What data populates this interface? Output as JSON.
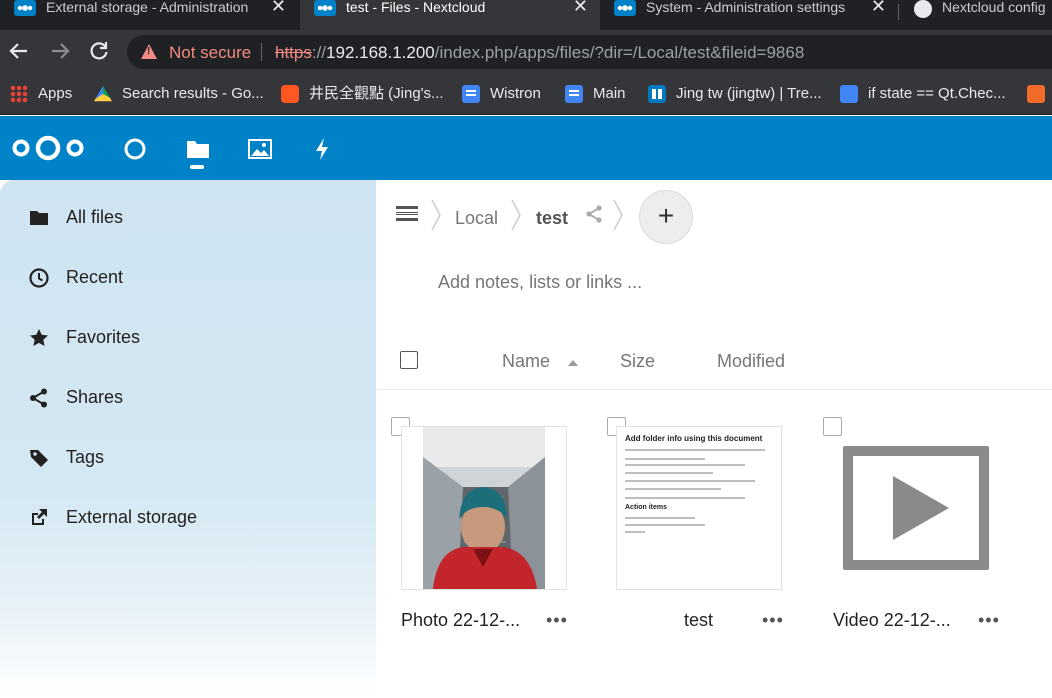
{
  "tabs": [
    {
      "title": "External storage - Administration",
      "active": false,
      "icon": "nextcloud-icon"
    },
    {
      "title": "test - Files - Nextcloud",
      "active": true,
      "icon": "nextcloud-icon"
    },
    {
      "title": "System - Administration settings",
      "active": false,
      "icon": "nextcloud-icon"
    },
    {
      "title": "Nextcloud config",
      "active": false,
      "icon": "globe-icon"
    }
  ],
  "close_glyph": "✕",
  "address": {
    "security_label": "Not secure",
    "scheme": "https",
    "scheme_sep": "://",
    "host": "192.168.1.200",
    "path": "/index.php/apps/files/?dir=/Local/test&fileid=9868"
  },
  "bookmarks": [
    {
      "label": "Apps",
      "icon": "apps-grid-icon"
    },
    {
      "label": "Search results - Go...",
      "icon": "google-drive-icon"
    },
    {
      "label": "井民全觀點 (Jing's...",
      "icon": "blogger-icon"
    },
    {
      "label": "Wistron",
      "icon": "google-docs-icon"
    },
    {
      "label": "Main",
      "icon": "google-docs-icon"
    },
    {
      "label": "Jing tw (jingtw) | Tre...",
      "icon": "trello-icon"
    },
    {
      "label": "if state == Qt.Chec...",
      "icon": "google-translate-icon"
    },
    {
      "label": "",
      "icon": "f-icon"
    }
  ],
  "nc_apps": [
    "dashboard-icon",
    "files-icon",
    "photos-icon",
    "activity-icon"
  ],
  "sidebar": {
    "items": [
      {
        "label": "All files",
        "icon": "folder-icon"
      },
      {
        "label": "Recent",
        "icon": "clock-icon"
      },
      {
        "label": "Favorites",
        "icon": "star-icon"
      },
      {
        "label": "Shares",
        "icon": "share-icon"
      },
      {
        "label": "Tags",
        "icon": "tag-icon"
      },
      {
        "label": "External storage",
        "icon": "external-link-icon"
      }
    ]
  },
  "breadcrumb": {
    "items": [
      "Local",
      "test"
    ]
  },
  "add_button": "+",
  "notes_placeholder": "Add notes, lists or links ...",
  "columns": {
    "name": "Name",
    "size": "Size",
    "modified": "Modified"
  },
  "files": [
    {
      "name": "Photo 22-12-...",
      "type": "image"
    },
    {
      "name": "test",
      "type": "document"
    },
    {
      "name": "Video 22-12-...",
      "type": "video"
    }
  ],
  "file_menu_glyph": "•••",
  "document_preview": {
    "title": "Add folder info using this document",
    "section": "Action items"
  },
  "colors": {
    "nextcloud_blue": "#0082c9",
    "chrome_dark": "#202124"
  }
}
